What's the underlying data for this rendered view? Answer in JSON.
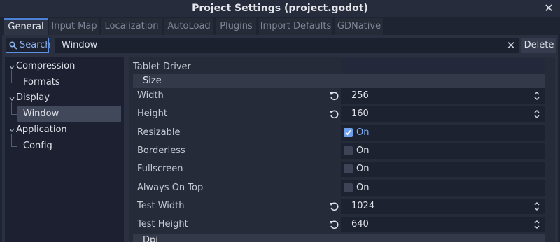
{
  "window": {
    "title": "Project Settings (project.godot)"
  },
  "tabs": [
    "General",
    "Input Map",
    "Localization",
    "AutoLoad",
    "Plugins",
    "Import Defaults",
    "GDNative"
  ],
  "toolbar": {
    "search_label": "Search",
    "filter_value": "Window",
    "delete_label": "Delete"
  },
  "tree": {
    "items": [
      "Compression",
      "Formats",
      "Display",
      "Window",
      "Application",
      "Config"
    ],
    "selected": "Window"
  },
  "inspector": {
    "top_label": "Tablet Driver",
    "section_size": "Size",
    "section_dpi": "Dpi",
    "rows": [
      {
        "label": "Width",
        "value": "256"
      },
      {
        "label": "Height",
        "value": "160"
      },
      {
        "label": "Resizable",
        "value": "On",
        "checked": true
      },
      {
        "label": "Borderless",
        "value": "On",
        "checked": false
      },
      {
        "label": "Fullscreen",
        "value": "On",
        "checked": false
      },
      {
        "label": "Always On Top",
        "value": "On",
        "checked": false
      },
      {
        "label": "Test Width",
        "value": "1024"
      },
      {
        "label": "Test Height",
        "value": "640"
      }
    ]
  },
  "colors": {
    "accent": "#5b8fe0",
    "checked": "#6ea0ee",
    "selection": "#414859"
  },
  "icons": [
    "close-icon",
    "search-icon",
    "clear-icon",
    "chevron-down-icon",
    "revert-icon",
    "spin-arrows-icon",
    "checkbox-icon"
  ]
}
